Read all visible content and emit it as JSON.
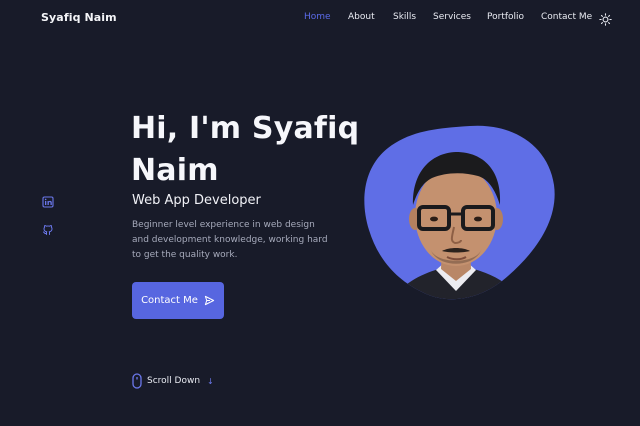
{
  "header": {
    "logo": "Syafiq Naim",
    "nav": [
      {
        "label": "Home",
        "active": true
      },
      {
        "label": "About",
        "active": false
      },
      {
        "label": "Skills",
        "active": false
      },
      {
        "label": "Services",
        "active": false
      },
      {
        "label": "Portfolio",
        "active": false
      },
      {
        "label": "Contact Me",
        "active": false
      }
    ],
    "theme_icon": "sun-icon"
  },
  "social": [
    {
      "icon": "linkedin-icon"
    },
    {
      "icon": "github-icon"
    }
  ],
  "hero": {
    "title": "Hi, I'm Syafiq Naim",
    "subtitle": "Web App Developer",
    "description": "Beginner level experience in web design and development knowledge, working hard to get the quality work.",
    "cta_label": "Contact Me",
    "cta_icon": "send-icon"
  },
  "scroll": {
    "label": "Scroll Down",
    "icon": "mouse-icon",
    "arrow": "↓"
  },
  "colors": {
    "background": "#181b29",
    "accent": "#5766e0",
    "text": "#f3f4f8",
    "muted": "#a6aabb"
  }
}
